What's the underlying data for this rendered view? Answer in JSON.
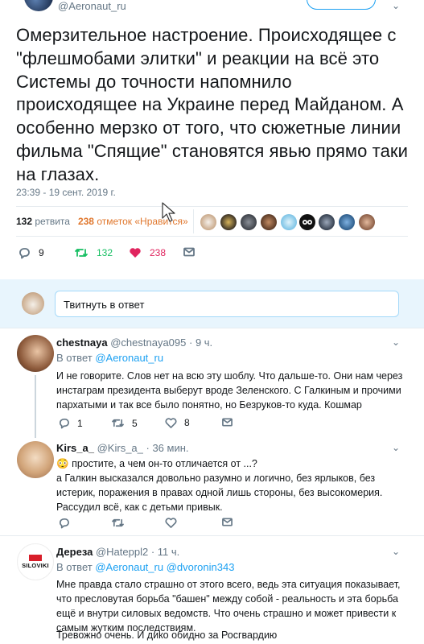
{
  "tweet": {
    "author_handle": "@Aeronaut_ru",
    "text": "Омерзительное настроение. Происходящее с \"флешмобами элитки\" и реакции на всё это Системы до точности напомнило происходящее на Украине перед Майданом. А особенно мерзко от того, что сюжетные линии фильма \"Спящие\" становятся явью прямо таки на глазах.",
    "timestamp": "23:39 - 19 сент. 2019 г.",
    "retweets_count": "132",
    "retweets_label": "ретвита",
    "likes_count": "238",
    "likes_label": "отметок «Нравится»",
    "actions": {
      "replies": "9",
      "retweets": "132",
      "likes": "238"
    }
  },
  "reply_compose": {
    "placeholder": "Твитнуть в ответ"
  },
  "replies": [
    {
      "name": "chestnaya",
      "handle": "@chestnaya095",
      "time": "· 9 ч.",
      "reply_to_label": "В ответ",
      "reply_to": "@Aeronaut_ru",
      "text": "И не говорите. Слов нет на всю эту шоблу. Что дальше-то. Они нам через инстаграм президента выберут вроде Зеленского. С Галкиным и прочими пархатыми и так все было понятно, но Безруков-то куда. Кошмар",
      "actions": {
        "replies": "1",
        "retweets": "5",
        "likes": "8"
      }
    },
    {
      "name": "Kirs_a_",
      "handle": "@Kirs_a_",
      "time": "· 36 мин.",
      "emoji": "😳",
      "text_line1": "простите, а чем он-то отличается от ...?",
      "text": "а Галкин высказался довольно разумно и логично, без ярлыков, без истерик, поражения в правах одной лишь стороны, без высокомерия. Рассудил всё, как с детьми привык.",
      "actions": {
        "replies": "",
        "retweets": "",
        "likes": ""
      }
    },
    {
      "name": "Дереза",
      "handle": "@Hateppl2",
      "time": "· 11 ч.",
      "logo_text": "SILOVIKI",
      "reply_to_label": "В ответ",
      "reply_to": "@Aeronaut_ru @dvoronin343",
      "text": "Мне правда стало страшно от этого всего, ведь эта ситуация показывает, что пресловутая борьба \"башен\" между собой - реальность и эта борьба ещё и внутри силовых ведомств. Что очень страшно и может привести к самым жутким последствиям.",
      "text_line2": "Тревожно очень. И дико обидно за Росгвардию"
    }
  ],
  "colors": {
    "accent": "#1da1f2",
    "like": "#e0245e",
    "retweet": "#17bf63",
    "stats_orange": "#e0772d",
    "secondary": "#657786"
  }
}
